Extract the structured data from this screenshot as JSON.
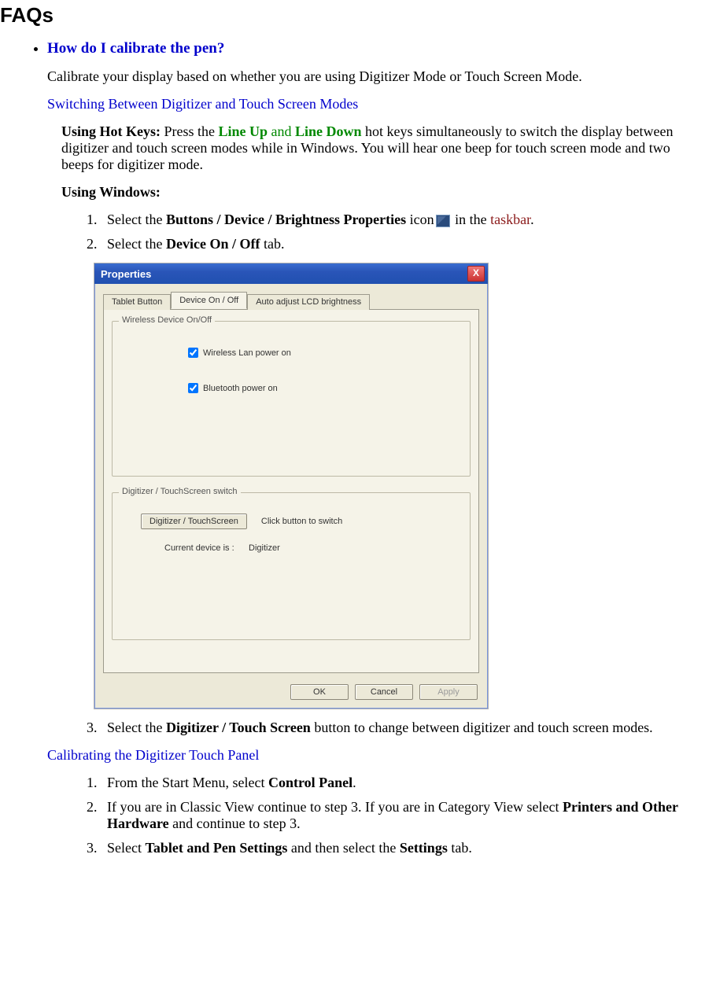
{
  "page": {
    "title": "FAQs"
  },
  "faq": {
    "question": "How do I calibrate the pen?",
    "intro": "Calibrate your display based on whether you are using Digitizer Mode or Touch Screen Mode.",
    "switch_heading": "Switching Between Digitizer and Touch Screen Modes",
    "hotkeys": {
      "lead_bold": "Using Hot Keys:",
      "t1": " Press the ",
      "lineup": "Line Up",
      "and": " and ",
      "linedown": "Line Down",
      "t2": " hot keys simultaneously to switch the display between digitizer and touch screen modes while in Windows. You will hear one beep for touch screen mode and two beeps for digitizer mode."
    },
    "using_windows": "Using Windows:",
    "steps_a": {
      "s1a": "Select the ",
      "s1b": "Buttons / Device / Brightness Properties",
      "s1c": " icon",
      "s1d": " in the ",
      "s1e": "taskbar",
      "s1f": ".",
      "s2a": "Select the ",
      "s2b": "Device On / Off",
      "s2c": "  tab.",
      "s3a": "Select the ",
      "s3b": "Digitizer / Touch Screen",
      "s3c": " button to change between digitizer and touch screen modes."
    },
    "calibrate_heading": "Calibrating the Digitizer Touch Panel",
    "steps_b": {
      "s1a": "From the Start Menu, select ",
      "s1b": "Control Panel",
      "s1c": ".",
      "s2a": "If you are in Classic View continue to step 3.  If you are in Category View select ",
      "s2b": "Printers and Other Hardware",
      "s2c": " and continue to step 3.",
      "s3a": "Select ",
      "s3b": "Tablet and Pen Settings",
      "s3c": " and then select the ",
      "s3d": "Settings",
      "s3e": " tab."
    }
  },
  "dialog": {
    "title": "Properties",
    "close_glyph": "X",
    "tabs": {
      "t1": "Tablet Button",
      "t2": "Device On / Off",
      "t3": "Auto adjust LCD brightness"
    },
    "group1": {
      "legend": "Wireless Device On/Off",
      "wlan": "Wireless Lan power on",
      "bt": "Bluetooth power on"
    },
    "group2": {
      "legend": "Digitizer / TouchScreen switch",
      "btn": "Digitizer / TouchScreen",
      "hint": "Click button to switch",
      "cur_lbl": "Current device is     :",
      "cur_val": "Digitizer"
    },
    "buttons": {
      "ok": "OK",
      "cancel": "Cancel",
      "apply": "Apply"
    }
  }
}
